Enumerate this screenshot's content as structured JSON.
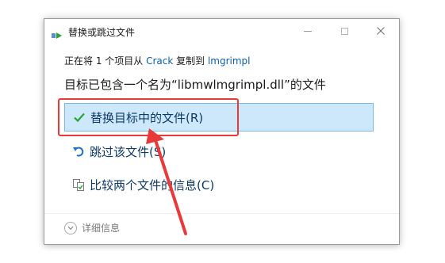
{
  "window": {
    "title": "替换或跳过文件"
  },
  "status": {
    "prefix": "正在将 1 个项目从 ",
    "source": "Crack",
    "middle": " 复制到 ",
    "destination": "lmgrimpl"
  },
  "heading": "目标已包含一个名为“libmwlmgrimpl.dll”的文件",
  "options": {
    "replace": {
      "label": "替换目标中的文件(R)",
      "icon": "checkmark-icon"
    },
    "skip": {
      "label": "跳过该文件(S)",
      "icon": "skip-arrow-icon"
    },
    "compare": {
      "label": "比较两个文件的信息(C)",
      "icon": "compare-files-icon"
    }
  },
  "details": {
    "label": "详细信息",
    "icon": "chevron-down-icon"
  },
  "colors": {
    "accent_check": "#2aa13a",
    "selection_bg": "#cde8fb",
    "annotation_red": "#e83a3a"
  }
}
